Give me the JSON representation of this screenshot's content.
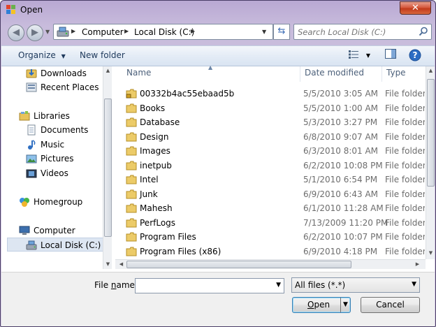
{
  "window": {
    "title": "Open",
    "close_glyph": "✕"
  },
  "nav": {
    "back_glyph": "◀",
    "forward_glyph": "▶",
    "history_glyph": "▼",
    "breadcrumb": [
      "Computer",
      "Local Disk (C:)"
    ],
    "refresh_glyph": "⇆",
    "search_placeholder": "Search Local Disk (C:)"
  },
  "toolbar": {
    "organize_label": "Organize",
    "new_folder_label": "New folder"
  },
  "sidebar": {
    "items": [
      {
        "label": "Downloads",
        "icon": "downloads-icon"
      },
      {
        "label": "Recent Places",
        "icon": "recent-places-icon"
      },
      {
        "label": "Libraries",
        "icon": "libraries-icon"
      },
      {
        "label": "Documents",
        "icon": "documents-icon"
      },
      {
        "label": "Music",
        "icon": "music-icon"
      },
      {
        "label": "Pictures",
        "icon": "pictures-icon"
      },
      {
        "label": "Videos",
        "icon": "videos-icon"
      },
      {
        "label": "Homegroup",
        "icon": "homegroup-icon"
      },
      {
        "label": "Computer",
        "icon": "computer-icon"
      },
      {
        "label": "Local Disk (C:)",
        "icon": "local-disk-icon",
        "selected": true
      }
    ]
  },
  "file_list": {
    "columns": {
      "name": "Name",
      "date": "Date modified",
      "type": "Type"
    },
    "rows": [
      {
        "name": "00332b4ac55ebaad5b",
        "date": "5/5/2010 3:05 AM",
        "type": "File folder",
        "locked": true
      },
      {
        "name": "Books",
        "date": "5/5/2010 1:00 AM",
        "type": "File folder"
      },
      {
        "name": "Database",
        "date": "5/3/2010 3:27 PM",
        "type": "File folder"
      },
      {
        "name": "Design",
        "date": "6/8/2010 9:07 AM",
        "type": "File folder"
      },
      {
        "name": "Images",
        "date": "6/3/2010 8:01 AM",
        "type": "File folder"
      },
      {
        "name": "inetpub",
        "date": "6/2/2010 10:08 PM",
        "type": "File folder"
      },
      {
        "name": "Intel",
        "date": "5/1/2010 6:54 PM",
        "type": "File folder"
      },
      {
        "name": "Junk",
        "date": "6/9/2010 6:43 AM",
        "type": "File folder"
      },
      {
        "name": "Mahesh",
        "date": "6/1/2010 11:28 AM",
        "type": "File folder"
      },
      {
        "name": "PerfLogs",
        "date": "7/13/2009 11:20 PM",
        "type": "File folder"
      },
      {
        "name": "Program Files",
        "date": "6/2/2010 10:07 PM",
        "type": "File folder"
      },
      {
        "name": "Program Files (x86)",
        "date": "6/9/2010 4:18 PM",
        "type": "File folder"
      }
    ]
  },
  "bottom": {
    "file_name_label_pre": "File ",
    "file_name_label_accel": "n",
    "file_name_label_post": "ame:",
    "file_name_value": "",
    "filter_value": "All files (*.*)",
    "open_label_accel": "O",
    "open_label_post": "pen",
    "cancel_label": "Cancel"
  }
}
